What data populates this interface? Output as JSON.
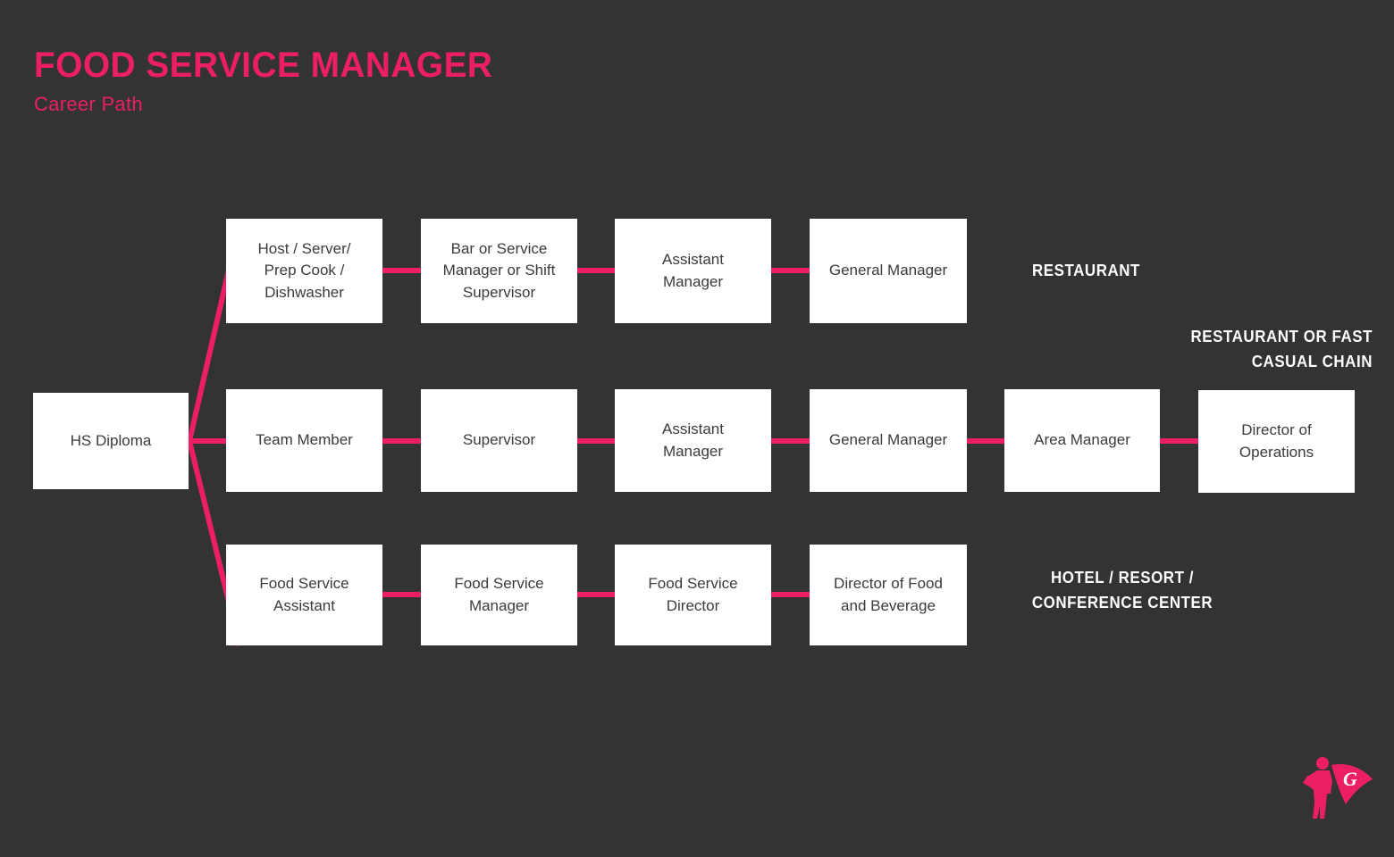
{
  "header": {
    "title": "FOOD SERVICE MANAGER",
    "subtitle": "Career Path"
  },
  "theme": {
    "background": "#333333",
    "accent": "#ec1e66",
    "node_fill": "#ffffff",
    "node_text": "#3b3b3b",
    "label_text": "#ffffff"
  },
  "chart_data": {
    "type": "diagram",
    "title": "FOOD SERVICE MANAGER Career Path",
    "start_node": "HS Diploma",
    "tracks": [
      {
        "id": "restaurant",
        "label": "RESTAURANT",
        "steps": [
          "Host / Server/\nPrep Cook /\nDishwasher",
          "Bar or Service\nManager or Shift\nSupervisor",
          "Assistant\nManager",
          "General Manager"
        ]
      },
      {
        "id": "restaurant-or-fast-casual-chain",
        "label": "RESTAURANT OR FAST\nCASUAL CHAIN",
        "steps": [
          "Team Member",
          "Supervisor",
          "Assistant\nManager",
          "General Manager",
          "Area Manager",
          "Director of\nOperations"
        ]
      },
      {
        "id": "hotel-resort-conference-center",
        "label": "HOTEL / RESORT /\nCONFERENCE CENTER",
        "steps": [
          "Food Service\nAssistant",
          "Food Service\nManager",
          "Food Service\nDirector",
          "Director of Food\nand Beverage"
        ]
      }
    ]
  },
  "nodes": {
    "start": "HS Diploma",
    "top": {
      "n0": "Host / Server/\nPrep Cook /\nDishwasher",
      "n1": "Bar or Service\nManager or Shift\nSupervisor",
      "n2": "Assistant\nManager",
      "n3": "General Manager"
    },
    "middle": {
      "n0": "Team Member",
      "n1": "Supervisor",
      "n2": "Assistant\nManager",
      "n3": "General Manager",
      "n4": "Area Manager",
      "n5": "Director of\nOperations"
    },
    "bottom": {
      "n0": "Food Service\nAssistant",
      "n1": "Food Service\nManager",
      "n2": "Food Service\nDirector",
      "n3": "Director of Food\nand Beverage"
    }
  },
  "stream_labels": {
    "top": "RESTAURANT",
    "middle": "RESTAURANT OR FAST\nCASUAL CHAIN",
    "bottom": "HOTEL / RESORT /\nCONFERENCE CENTER"
  },
  "logo": {
    "letter": "G",
    "name": "superhero-logo"
  }
}
